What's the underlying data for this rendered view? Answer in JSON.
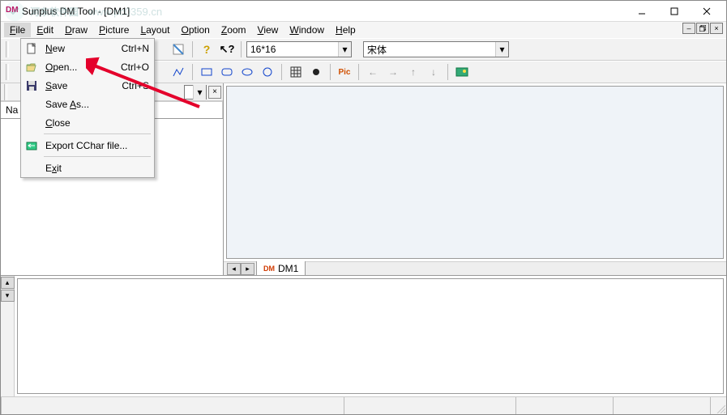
{
  "title": "Sunplus DM Tool - [DM1]",
  "watermark": {
    "text": "河东软件园",
    "url": "www.pc0359.cn"
  },
  "menubar": {
    "items": [
      "File",
      "Edit",
      "Draw",
      "Picture",
      "Layout",
      "Option",
      "Zoom",
      "View",
      "Window",
      "Help"
    ],
    "accel": [
      "F",
      "E",
      "D",
      "P",
      "L",
      "O",
      "Z",
      "V",
      "W",
      "H"
    ],
    "active_index": 0
  },
  "file_menu": {
    "items": [
      {
        "icon": "new",
        "label": "New",
        "u": "N",
        "shortcut": "Ctrl+N"
      },
      {
        "icon": "open",
        "label": "Open...",
        "u": "O",
        "shortcut": "Ctrl+O"
      },
      {
        "icon": "save",
        "label": "Save",
        "u": "S",
        "shortcut": "Ctrl+S"
      },
      {
        "icon": "",
        "label": "Save As...",
        "u": "A",
        "shortcut": ""
      },
      {
        "icon": "",
        "label": "Close",
        "u": "C",
        "shortcut": ""
      },
      {
        "sep": true
      },
      {
        "icon": "export",
        "label": "Export CChar file...",
        "u": "",
        "shortcut": ""
      },
      {
        "sep": true
      },
      {
        "icon": "",
        "label": "Exit",
        "u": "x",
        "shortcut": ""
      }
    ]
  },
  "toolbar1": {
    "size_combo": "16*16",
    "font_combo": "宋体"
  },
  "toolbar2": {},
  "left_panel": {
    "col_label": "Na"
  },
  "doc_tab": {
    "label": "DM1"
  },
  "mdi_buttons": [
    "minimize",
    "restore",
    "close"
  ],
  "win_buttons": [
    "minimize",
    "maximize",
    "close"
  ]
}
